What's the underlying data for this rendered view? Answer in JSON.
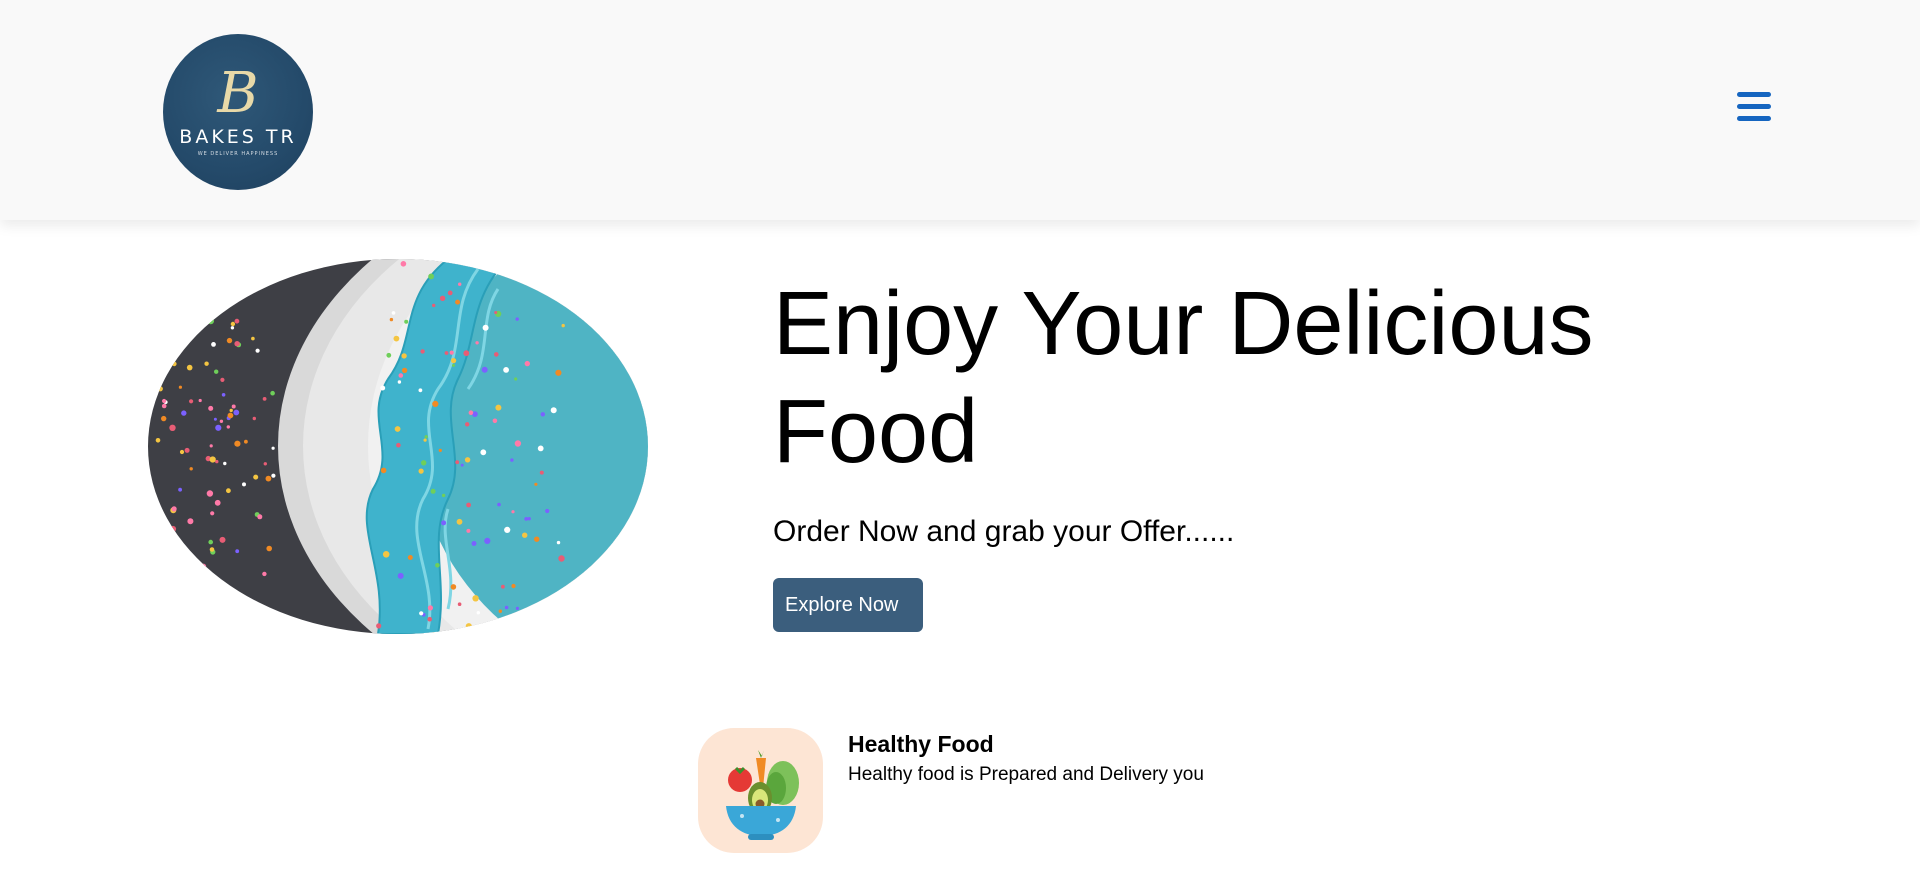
{
  "header": {
    "logo": {
      "monogram": "B",
      "name": "BAKES TR",
      "tagline": "WE DELIVER HAPPINESS",
      "color": "#2a4f70"
    },
    "menu_icon": "hamburger-icon",
    "accent_color": "#1565c0"
  },
  "hero": {
    "image_icon": "decorated-cake-photo",
    "title": "Enjoy Your Delicious Food",
    "subtitle": "Order Now and grab your Offer......",
    "cta_label": "Explore Now",
    "cta_color": "#3b5e7d"
  },
  "features": [
    {
      "icon": "salad-bowl-icon",
      "title": "Healthy Food",
      "description": "Healthy food is Prepared and Delivery you"
    }
  ]
}
